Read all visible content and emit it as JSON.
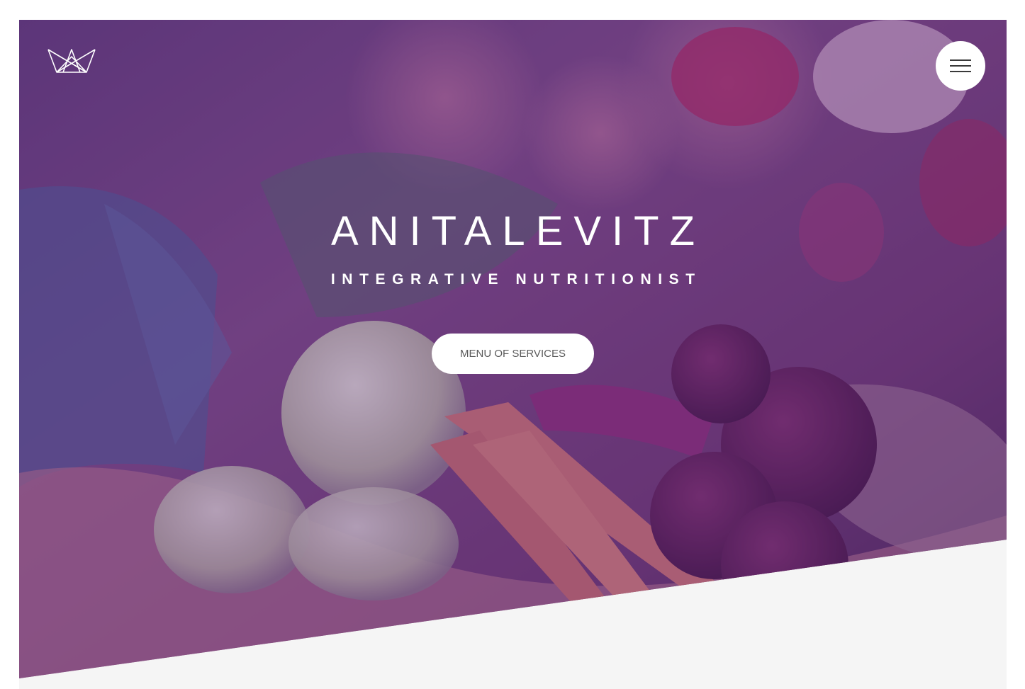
{
  "header": {
    "logo_icon": "crown-outline-icon",
    "menu_icon": "hamburger-menu-icon"
  },
  "hero": {
    "title": "ANITALEVITZ",
    "subtitle": "INTEGRATIVE NUTRITIONIST",
    "cta_label": "MENU OF SERVICES"
  },
  "colors": {
    "overlay": "#5f2878",
    "cta_background": "#ffffff",
    "cta_text": "#5a5a5a",
    "below_fold_background": "#f5f5f5"
  }
}
